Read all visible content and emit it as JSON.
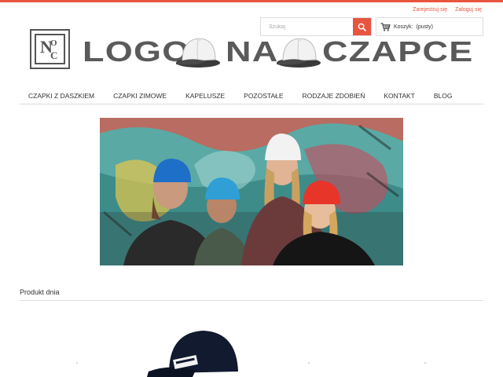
{
  "header": {
    "account_links": {
      "register": "Zarejestruj się",
      "login": "Zaloguj się"
    },
    "search": {
      "placeholder": "Szukaj"
    },
    "cart": {
      "label": "Koszyk:",
      "status": "(pusty)"
    },
    "logo": {
      "mark_letters": [
        "N",
        "O",
        "C"
      ],
      "words": [
        "LOGO",
        "NA",
        "CZAPCE"
      ]
    }
  },
  "nav": {
    "items": [
      "CZAPKI Z DASZKIEM",
      "CZAPKI ZIMOWE",
      "KAPELUSZE",
      "POZOSTAŁE",
      "RODZAJE ZDOBIEŃ",
      "KONTAKT",
      "BLOG"
    ]
  },
  "main": {
    "section_title": "Produkt dnia"
  },
  "colors": {
    "accent": "#e8553f",
    "logo_gray": "#5a5a5a"
  },
  "icons": {
    "search": "search-icon",
    "cart": "cart-icon"
  }
}
